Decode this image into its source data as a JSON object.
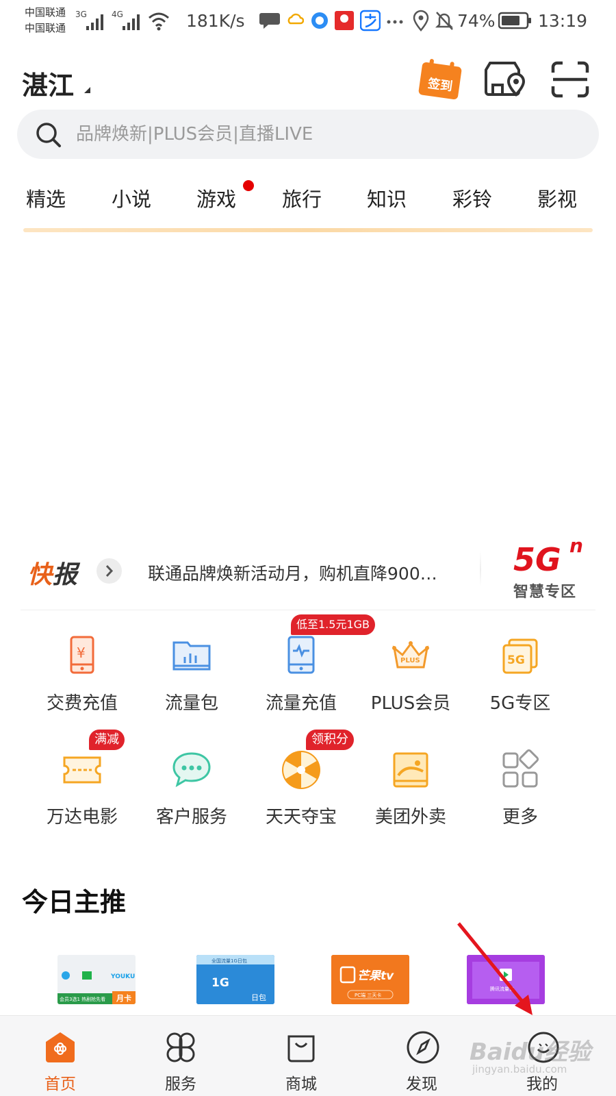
{
  "status_bar": {
    "carrier_1": "中国联通",
    "carrier_2": "中国联通",
    "net_1": "3G",
    "net_2": "4G",
    "speed": "181K/s",
    "battery": "74%",
    "time": "13:19",
    "icons": [
      "message-icon",
      "cloud-icon",
      "browser-icon",
      "app-icon",
      "alipay-icon",
      "more-dots-icon",
      "location-icon",
      "mute-icon",
      "battery-icon"
    ]
  },
  "header": {
    "city": "湛江",
    "sign_in_label": "签到",
    "icons": [
      "sign-in-icon",
      "store-location-icon",
      "scan-icon"
    ]
  },
  "search": {
    "placeholder": "品牌焕新|PLUS会员|直播LIVE"
  },
  "tabs": [
    "精选",
    "小说",
    "游戏",
    "旅行",
    "知识",
    "彩铃",
    "影视"
  ],
  "news": {
    "title_1": "快",
    "title_2": "报",
    "text": "联通品牌焕新活动月，购机直降900…",
    "zone_big": "5G",
    "zone_sup": "n",
    "zone_sub": "智慧专区"
  },
  "grid": [
    {
      "label": "交费充值",
      "icon": "payment-phone-icon",
      "color": "#f26b3a"
    },
    {
      "label": "流量包",
      "icon": "data-package-icon",
      "color": "#4a90e2"
    },
    {
      "label": "流量充值",
      "icon": "data-recharge-icon",
      "color": "#4a90e2",
      "badge": "低至1.5元1GB"
    },
    {
      "label": "PLUS会员",
      "icon": "crown-icon",
      "color": "#f39a2b"
    },
    {
      "label": "5G专区",
      "icon": "5g-zone-icon",
      "color": "#f5a623"
    },
    {
      "label": "万达电影",
      "icon": "ticket-icon",
      "color": "#f5a623",
      "badge": "满减"
    },
    {
      "label": "客户服务",
      "icon": "chat-icon",
      "color": "#3ec6a4"
    },
    {
      "label": "天天夺宝",
      "icon": "wheel-icon",
      "color": "#f59b1b",
      "badge": "领积分"
    },
    {
      "label": "美团外卖",
      "icon": "meituan-icon",
      "color": "#f5a623"
    },
    {
      "label": "更多",
      "icon": "more-grid-icon",
      "color": "#999999"
    }
  ],
  "recommendations": {
    "title": "今日主推",
    "items": [
      {
        "name": "video-bundle-card",
        "line1": "YOUKU",
        "tag": "月卡",
        "note": "会员3选1 热剧抢先看"
      },
      {
        "name": "data-1g-card",
        "line1": "全国流量1G日包",
        "big": "1G",
        "tag": "日包"
      },
      {
        "name": "mango-tv-card",
        "line1": "芒果tv",
        "note": "PC端 三天卡"
      },
      {
        "name": "tencent-data-card",
        "line1": "腾讯流量包"
      }
    ]
  },
  "tabbar": [
    {
      "label": "首页",
      "icon": "home-icon",
      "active": true
    },
    {
      "label": "服务",
      "icon": "services-icon",
      "active": false
    },
    {
      "label": "商城",
      "icon": "shop-bag-icon",
      "active": false
    },
    {
      "label": "发现",
      "icon": "compass-icon",
      "active": false
    },
    {
      "label": "我的",
      "icon": "profile-icon",
      "active": false
    }
  ],
  "watermark": {
    "text": "Baidu经验",
    "sub": "jingyan.baidu.com"
  },
  "colors": {
    "accent": "#e8611a",
    "badge": "#e0232b",
    "annotation_arrow": "#e4161e"
  }
}
